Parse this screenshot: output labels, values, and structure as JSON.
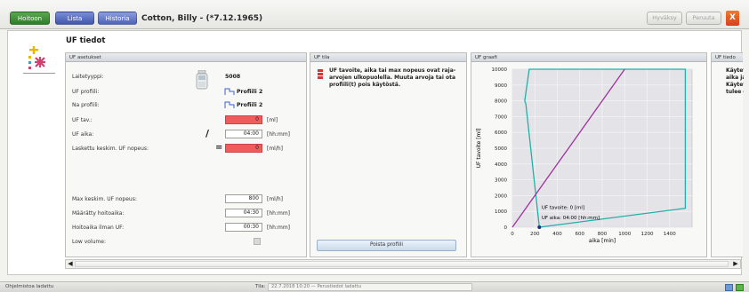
{
  "header": {
    "tab_green": "Hoitoon",
    "tab_lista": "Lista",
    "tab_historia": "Historia",
    "patient": "Cotton, Billy - (*7.12.1965)",
    "btn_hyvaksy": "Hyväksy",
    "btn_peruuta": "Peruuta",
    "btn_close": "X"
  },
  "section_title": "UF tiedot",
  "uf_settings": {
    "title": "UF asetukset",
    "device_label": "Laitetyyppi:",
    "device_value": "5008",
    "profile_label": "UF profiili:",
    "profile_value": "Profiili 2",
    "na_profile_label": "Na profiili:",
    "na_profile_value": "Profiili 2",
    "uf_goal_label": "UF tav.:",
    "uf_goal_value": "0",
    "uf_goal_unit": "[ml]",
    "uf_time_label": "UF aika:",
    "uf_time_value": "04:00",
    "uf_time_unit": "[hh:mm]",
    "calc_rate_label": "Laskettu keskim. UF nopeus:",
    "calc_rate_value": "0",
    "calc_rate_unit": "[ml/h]",
    "divide_symbol": "/",
    "equals_symbol": "=",
    "max_rate_label": "Max keskim. UF nopeus:",
    "max_rate_value": "800",
    "max_rate_unit": "[ml/h]",
    "treatment_time_label": "Määrätty hoitoaika:",
    "treatment_time_value": "04:30",
    "treatment_time_unit": "[hh:mm]",
    "no_uf_time_label": "Hoitoaika ilman UF:",
    "no_uf_time_value": "00:30",
    "no_uf_time_unit": "[hh:mm]",
    "low_volume_label": "Low volume:"
  },
  "uf_state": {
    "title": "UF tila",
    "warning": "UF tavoite, aika tai max nopeus ovat raja-arvojen ulkopuolella. Muuta arvoja tai ota profiili(t) pois käytöstä.",
    "remove_button": "Poista profiili"
  },
  "uf_graph": {
    "title": "UF graafi"
  },
  "uf_info": {
    "title": "UF tiedo",
    "text_lines": [
      "Käytet",
      "aika ja",
      "Käytet",
      "tulee o"
    ]
  },
  "chart_data": {
    "type": "line",
    "xlabel": "aika [min]",
    "ylabel": "UF tavoite [ml]",
    "xlim": [
      0,
      1600
    ],
    "ylim": [
      0,
      10000
    ],
    "x_ticks": [
      0,
      200,
      400,
      600,
      800,
      1000,
      1200,
      1400
    ],
    "y_ticks": [
      0,
      1000,
      2000,
      3000,
      4000,
      5000,
      6000,
      7000,
      8000,
      9000,
      10000
    ],
    "grid": true,
    "series": [
      {
        "color": "#20b0a8",
        "x": [
          240,
          120,
          110,
          150,
          1540,
          1540,
          240
        ],
        "y": [
          0,
          7800,
          8000,
          10000,
          10000,
          1200,
          0
        ]
      },
      {
        "color": "#a030a0",
        "x": [
          0,
          1000
        ],
        "y": [
          0,
          10000
        ]
      }
    ],
    "point": {
      "x": 240,
      "y": 0,
      "color": "#1a2b8a"
    },
    "annotations": [
      "UF tavoite: 0 [ml]",
      "UF aika: 04:00 [hh:mm]"
    ]
  },
  "status": {
    "left": "Ohjelmistoa ladattu",
    "tila_label": "Tila:",
    "tila_value": "22.7.2018 10:20 — Perustiedot ladattu"
  },
  "colors": {
    "accent_red": "#f05c5c",
    "tab_blue": "#4256ad",
    "graph_teal": "#20b0a8",
    "graph_purple": "#a030a0"
  }
}
